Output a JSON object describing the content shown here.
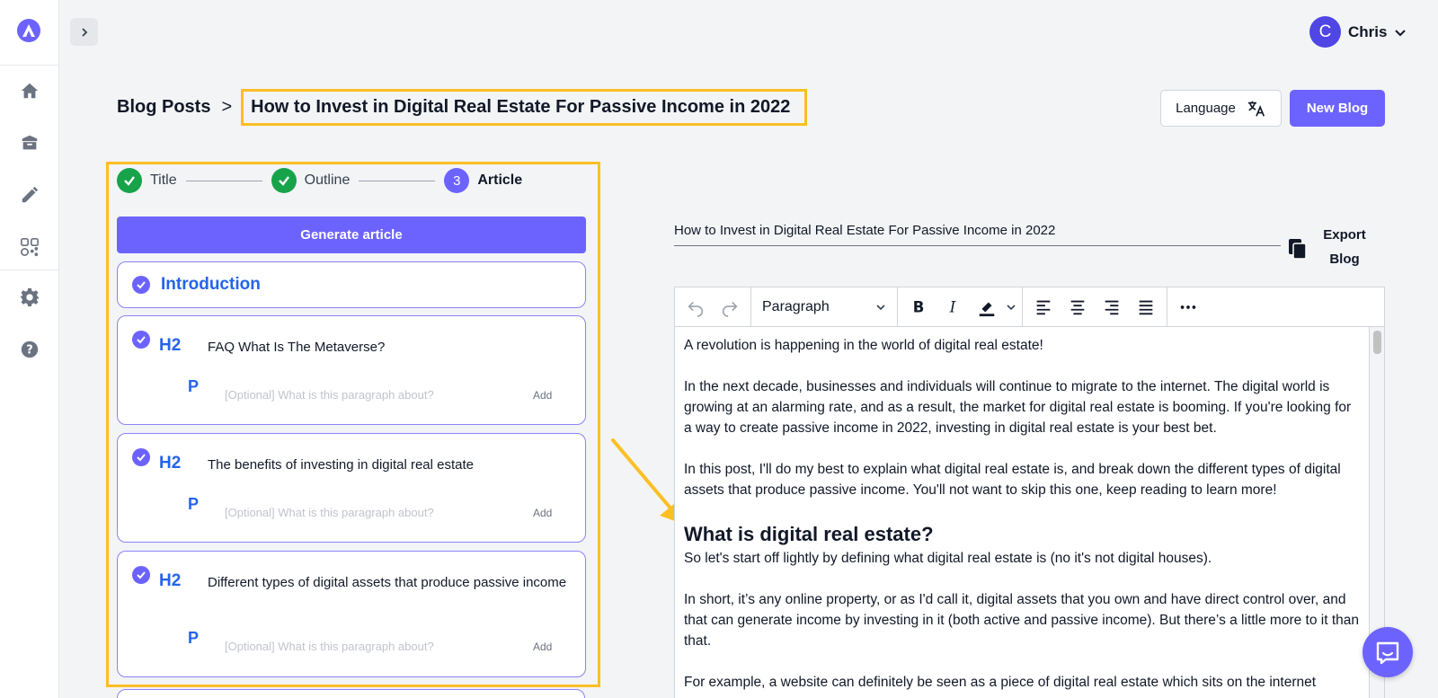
{
  "user": {
    "initial": "C",
    "name": "Chris"
  },
  "breadcrumb": {
    "root": "Blog Posts",
    "separator": ">",
    "current": "How to Invest in Digital Real Estate For Passive Income in 2022"
  },
  "header_actions": {
    "language_label": "Language",
    "new_blog_label": "New Blog"
  },
  "steps": [
    {
      "label": "Title",
      "state": "done"
    },
    {
      "label": "Outline",
      "state": "done"
    },
    {
      "number": "3",
      "label": "Article",
      "state": "active"
    }
  ],
  "generate_label": "Generate article",
  "intro_label": "Introduction",
  "sections": [
    {
      "tag": "H2",
      "heading": "FAQ What Is The Metaverse?",
      "p_tag": "P",
      "placeholder": "[Optional] What is this paragraph about?",
      "add_label": "Add"
    },
    {
      "tag": "H2",
      "heading": "The benefits of investing in digital real estate",
      "p_tag": "P",
      "placeholder": "[Optional] What is this paragraph about?",
      "add_label": "Add"
    },
    {
      "tag": "H2",
      "heading": "Different types of digital assets that produce passive income",
      "p_tag": "P",
      "placeholder": "[Optional] What is this paragraph about?",
      "add_label": "Add"
    }
  ],
  "editor": {
    "title_value": "How to Invest in Digital Real Estate For Passive Income in 2022",
    "export_label_line1": "Export",
    "export_label_line2": "Blog",
    "block_format": "Paragraph",
    "content": {
      "p1": "A revolution is happening in the world of digital real estate!",
      "p2": "In the next decade, businesses and individuals will continue to migrate to the internet. The digital world is growing at an alarming rate, and as a result, the market for digital real estate is booming. If you're looking for a way to create passive income in 2022, investing in digital real estate is your best bet.",
      "p3": "In this post, I'll do my best to explain what digital real estate is, and break down the different types of digital assets that produce passive income. You'll not want to skip this one, keep reading to learn more!",
      "h2": "What is digital real estate?",
      "p4": "So let's start off lightly by defining what digital real estate is (no it's not digital houses).",
      "p5": "In short, it’s any online property, or as I'd call it, digital assets that you own and have direct control over, and that can generate income by investing in it (both active and passive income). But there’s a little more to it than that.",
      "p6": "For example, a website can definitely be seen as a piece of digital real estate which sits on the internet"
    }
  },
  "colors": {
    "accent": "#6c63ff",
    "highlight": "#fbbf24",
    "success": "#16a34a",
    "link": "#2563eb"
  },
  "icons": [
    "logo-icon",
    "home-icon",
    "box-icon",
    "pencil-icon",
    "social-icon",
    "gear-icon",
    "help-icon",
    "chevron-right-icon",
    "chevron-down-icon",
    "translate-icon",
    "copy-icon",
    "undo-icon",
    "redo-icon",
    "bold-icon",
    "italic-icon",
    "highlight-icon",
    "align-left-icon",
    "align-center-icon",
    "align-right-icon",
    "align-justify-icon",
    "more-icon",
    "chat-icon"
  ]
}
